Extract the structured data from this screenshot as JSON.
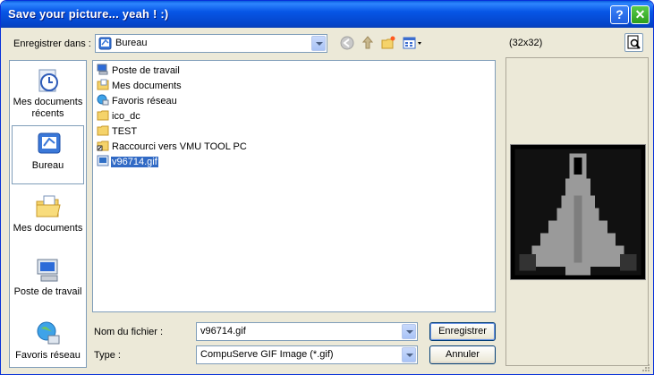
{
  "window": {
    "title": "Save your picture... yeah ! :)"
  },
  "save_in": {
    "label": "Enregistrer dans :",
    "value": "Bureau"
  },
  "preview": {
    "size_text": "(32x32)"
  },
  "places": [
    {
      "label": "Mes documents récents"
    },
    {
      "label": "Bureau"
    },
    {
      "label": "Mes documents"
    },
    {
      "label": "Poste de travail"
    },
    {
      "label": "Favoris réseau"
    }
  ],
  "files": [
    {
      "name": "Poste de travail",
      "icon": "computer-icon"
    },
    {
      "name": "Mes documents",
      "icon": "folder-documents-icon"
    },
    {
      "name": "Favoris réseau",
      "icon": "network-icon"
    },
    {
      "name": "ico_dc",
      "icon": "folder-icon"
    },
    {
      "name": "TEST",
      "icon": "folder-icon"
    },
    {
      "name": "Raccourci vers VMU TOOL PC",
      "icon": "folder-shortcut-icon"
    },
    {
      "name": "v96714.gif",
      "icon": "gif-file-icon",
      "selected": true
    }
  ],
  "filename": {
    "label": "Nom du fichier :",
    "value": "v96714.gif"
  },
  "filetype": {
    "label": "Type :",
    "value": "CompuServe GIF Image (*.gif)"
  },
  "buttons": {
    "save": "Enregistrer",
    "cancel": "Annuler"
  },
  "colors": {
    "titlebar": "#0054e3",
    "selection": "#316ac5",
    "dialog_bg": "#ece9d8"
  }
}
